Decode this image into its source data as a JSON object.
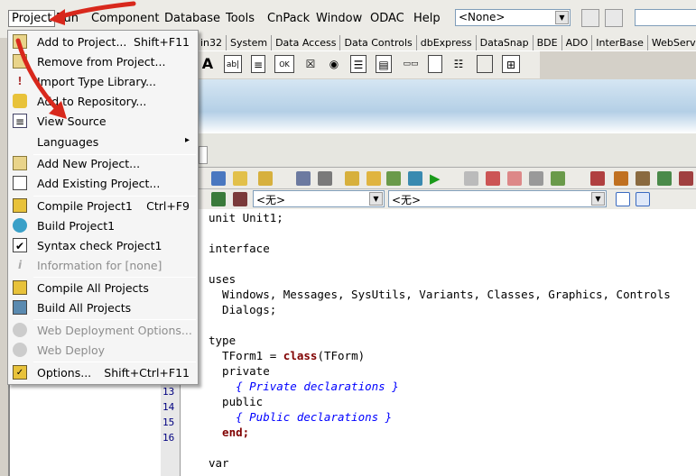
{
  "menubar": {
    "items": [
      "Project",
      "Run",
      "Component",
      "Database",
      "Tools",
      "CnPack",
      "Window",
      "ODAC",
      "Help"
    ],
    "desktop_combo": "<None>"
  },
  "palette": {
    "tabs": [
      "in32",
      "System",
      "Data Access",
      "Data Controls",
      "dbExpress",
      "DataSnap",
      "BDE",
      "ADO",
      "InterBase",
      "WebServices"
    ]
  },
  "selectors": {
    "class_combo": "<无>",
    "method_combo": "<无>"
  },
  "project_menu": {
    "items": [
      {
        "label": "Add to Project...",
        "shortcut": "Shift+F11",
        "icon": "add-to-project-icon"
      },
      {
        "label": "Remove from Project...",
        "shortcut": "",
        "icon": "remove-from-project-icon"
      },
      {
        "label": "Import Type Library...",
        "shortcut": "",
        "icon": "import-type-library-icon"
      },
      {
        "label": "Add to Repository...",
        "shortcut": "",
        "icon": "add-to-repository-icon"
      },
      {
        "label": "View Source",
        "shortcut": "",
        "icon": "view-source-icon"
      },
      {
        "label": "Languages",
        "shortcut": "▸",
        "icon": ""
      },
      {
        "label": "Add New Project...",
        "shortcut": "",
        "icon": "add-new-project-icon"
      },
      {
        "label": "Add Existing Project...",
        "shortcut": "",
        "icon": "add-existing-project-icon"
      },
      {
        "label": "Compile Project1",
        "shortcut": "Ctrl+F9",
        "icon": "compile-icon"
      },
      {
        "label": "Build Project1",
        "shortcut": "",
        "icon": "build-icon"
      },
      {
        "label": "Syntax check Project1",
        "shortcut": "",
        "icon": "syntax-check-icon"
      },
      {
        "label": "Information for [none]",
        "shortcut": "",
        "icon": "information-icon"
      },
      {
        "label": "Compile All Projects",
        "shortcut": "",
        "icon": "compile-all-icon"
      },
      {
        "label": "Build All Projects",
        "shortcut": "",
        "icon": "build-all-icon"
      },
      {
        "label": "Web Deployment Options...",
        "shortcut": "",
        "icon": "web-deployment-options-icon"
      },
      {
        "label": "Web Deploy",
        "shortcut": "",
        "icon": "web-deploy-icon"
      },
      {
        "label": "Options...",
        "shortcut": "Shift+Ctrl+F11",
        "icon": "options-icon"
      }
    ]
  },
  "gutter": [
    "13",
    "14",
    "15",
    "16"
  ],
  "code": {
    "l1": "unit Unit1;",
    "l2": "interface",
    "l3": "uses",
    "l4": "  Windows, Messages, SysUtils, Variants, Classes, Graphics, Controls",
    "l5": "  Dialogs;",
    "l6": "type",
    "l7a": "  TForm1 = ",
    "l7b": "class",
    "l7c": "(TForm)",
    "l8": "  private",
    "l9": "    { Private declarations }",
    "l10": "  public",
    "l11": "    { Public declarations }",
    "l12": "  end;",
    "l13": "var"
  },
  "colors": {
    "arrow": "#d8281c",
    "menu_bg": "#f5f5f5"
  }
}
